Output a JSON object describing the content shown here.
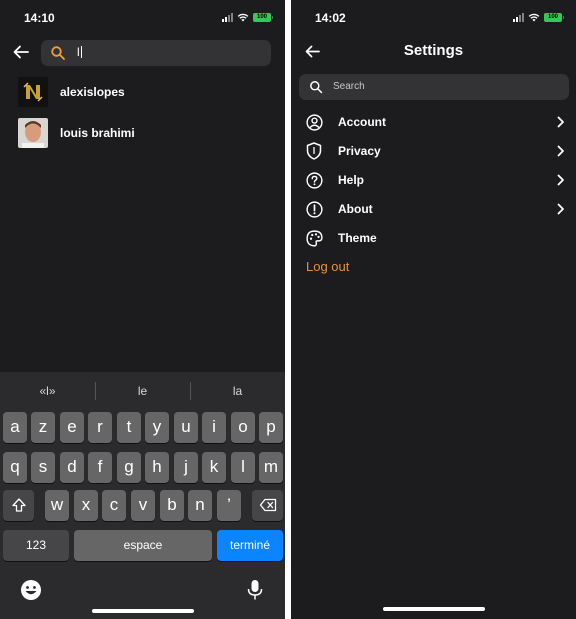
{
  "left_screen": {
    "status": {
      "time": "14:10",
      "battery": "100"
    },
    "search": {
      "value": "l"
    },
    "results": [
      {
        "name": "alexislopes",
        "avatar": "logo-avatar"
      },
      {
        "name": "louis brahimi",
        "avatar": "photo-avatar"
      }
    ],
    "keyboard": {
      "suggestions": [
        "«l»",
        "le",
        "la"
      ],
      "row1": [
        "a",
        "z",
        "e",
        "r",
        "t",
        "y",
        "u",
        "i",
        "o",
        "p"
      ],
      "row2": [
        "q",
        "s",
        "d",
        "f",
        "g",
        "h",
        "j",
        "k",
        "l",
        "m"
      ],
      "row3": [
        "w",
        "x",
        "c",
        "v",
        "b",
        "n",
        "’"
      ],
      "numbers_label": "123",
      "space_label": "espace",
      "done_label": "terminé",
      "icons": [
        "shift-icon",
        "backspace-icon",
        "emoji-icon",
        "microphone-icon"
      ]
    }
  },
  "right_screen": {
    "status": {
      "time": "14:02",
      "battery": "100"
    },
    "title": "Settings",
    "search": {
      "placeholder": "Search"
    },
    "menu": [
      {
        "label": "Account",
        "icon": "account-icon",
        "chevron": true
      },
      {
        "label": "Privacy",
        "icon": "privacy-shield-icon",
        "chevron": true
      },
      {
        "label": "Help",
        "icon": "help-icon",
        "chevron": true
      },
      {
        "label": "About",
        "icon": "about-icon",
        "chevron": true
      },
      {
        "label": "Theme",
        "icon": "palette-icon",
        "chevron": false
      }
    ],
    "logout_label": "Log out"
  },
  "colors": {
    "background": "#1c1c1e",
    "search_field": "#333335",
    "accent_search_icon": "#f0a03c",
    "logout": "#e8913a",
    "keyboard_go": "#0a84ff",
    "battery": "#34c759"
  }
}
